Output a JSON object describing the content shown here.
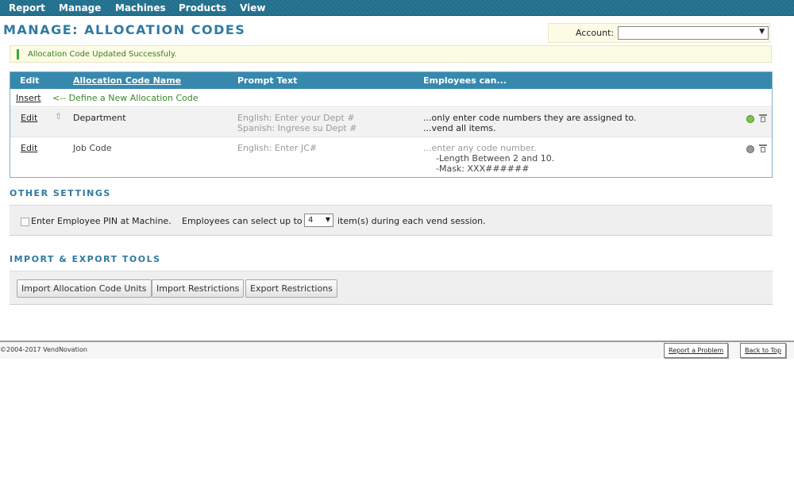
{
  "nav": {
    "items": [
      "Report",
      "Manage",
      "Machines",
      "Products",
      "View"
    ]
  },
  "page_title": "MANAGE: ALLOCATION CODES",
  "account": {
    "label": "Account:",
    "value": ""
  },
  "alert": {
    "message": "Allocation Code Updated Successfuly."
  },
  "table": {
    "headers": {
      "edit": "Edit",
      "name": "Allocation Code Name",
      "prompt": "Prompt Text",
      "employees": "Employees can..."
    },
    "insert": {
      "link": "Insert",
      "hint": "<-- Define a New Allocation Code"
    },
    "rows": [
      {
        "edit": "Edit",
        "name": "Department",
        "prompt": [
          "English: Enter your Dept #",
          "Spanish: Ingrese su Dept #"
        ],
        "employees": [
          "...only enter code numbers they are assigned to.",
          "...vend all items."
        ],
        "status": "active"
      },
      {
        "edit": "Edit",
        "name": "Job Code",
        "prompt": [
          "English: Enter JC#"
        ],
        "employees": [
          "...enter any code number.",
          "-Length Between 2 and 10.",
          "-Mask: XXX######"
        ],
        "status": "inactive"
      }
    ]
  },
  "other_settings": {
    "title": "OTHER SETTINGS",
    "pin_label": "Enter Employee PIN at Machine.",
    "select_prefix": "Employees can select up to",
    "select_value": "4",
    "select_suffix": "item(s) during each vend session."
  },
  "tools": {
    "title": "IMPORT & EXPORT TOOLS",
    "buttons": [
      "Import Allocation Code Units",
      "Import Restrictions",
      "Export Restrictions"
    ]
  },
  "footer": {
    "copyright": "©2004-2017 VendNovation",
    "report_problem": "Report a Problem",
    "back_to_top": "Back to Top"
  },
  "colors": {
    "nav_bg": "#1f6e8c",
    "title": "#2f7aa0",
    "table_header": "#3689ad",
    "success_text": "#3a7a22",
    "active_status": "#7ec24a"
  },
  "icons": [
    "move-up-icon",
    "status-active-icon",
    "status-inactive-icon",
    "trash-icon",
    "dropdown-arrow-icon"
  ]
}
